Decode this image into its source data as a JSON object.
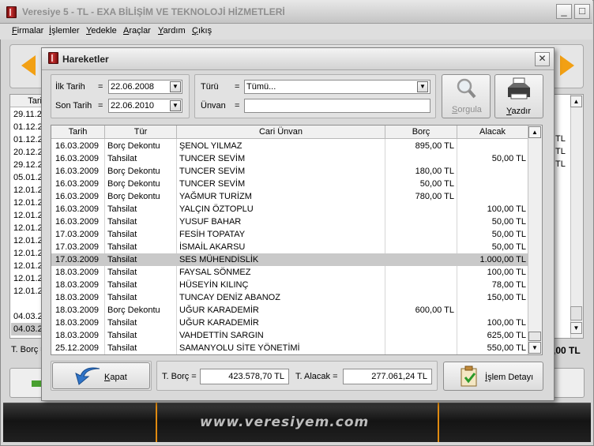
{
  "window": {
    "title": "Veresiye 5 - TL - EXA BİLİŞİM VE TEKNOLOJİ HİZMETLERİ",
    "minimize": "_",
    "restore": "□",
    "close": "✕"
  },
  "menu": [
    "Firmalar",
    "İşlemler",
    "Yedekle",
    "Araçlar",
    "Yardım",
    "Çıkış"
  ],
  "background": {
    "grid_header": "Tari",
    "dates": [
      "29.11.2",
      "01.12.2",
      "01.12.2",
      "20.12.2",
      "29.12.2",
      "05.01.2",
      "12.01.2",
      "12.01.2",
      "12.01.2",
      "12.01.2",
      "12.01.2",
      "12.01.2",
      "12.01.2",
      "12.01.2",
      "12.01.2",
      "04.03.2",
      "04.03.2"
    ],
    "tl_values": [
      "TL",
      "TL",
      "TL",
      "TL"
    ],
    "footer_left": "T. Borç =",
    "footer_right": ",00 TL",
    "banner": "www.veresiyem.com"
  },
  "dialog": {
    "title": "Hareketler",
    "close": "✕",
    "filters": {
      "start_label": "İlk Tarih",
      "start_value": "22.06.2008",
      "end_label": "Son Tarih",
      "end_value": "22.06.2010",
      "type_label": "Türü",
      "type_value": "Tümü...",
      "title_label": "Ünvan",
      "title_value": "",
      "eq": "="
    },
    "query_button": "Sorgula",
    "print_button": "Yazdır",
    "columns": [
      "Tarih",
      "Tür",
      "Cari Ünvan",
      "Borç",
      "Alacak"
    ],
    "rows": [
      {
        "date": "16.03.2009",
        "type": "Borç Dekontu",
        "name": "ŞENOL YILMAZ",
        "debt": "895,00 TL",
        "credit": ""
      },
      {
        "date": "16.03.2009",
        "type": "Tahsilat",
        "name": "TUNCER SEVİM",
        "debt": "",
        "credit": "50,00 TL"
      },
      {
        "date": "16.03.2009",
        "type": "Borç Dekontu",
        "name": "TUNCER SEVİM",
        "debt": "180,00 TL",
        "credit": ""
      },
      {
        "date": "16.03.2009",
        "type": "Borç Dekontu",
        "name": "TUNCER SEVİM",
        "debt": "50,00 TL",
        "credit": ""
      },
      {
        "date": "16.03.2009",
        "type": "Borç Dekontu",
        "name": "YAĞMUR TURİZM",
        "debt": "780,00 TL",
        "credit": ""
      },
      {
        "date": "16.03.2009",
        "type": "Tahsilat",
        "name": "YALÇIN ÖZTOPLU",
        "debt": "",
        "credit": "100,00 TL"
      },
      {
        "date": "16.03.2009",
        "type": "Tahsilat",
        "name": "YUSUF BAHAR",
        "debt": "",
        "credit": "50,00 TL"
      },
      {
        "date": "17.03.2009",
        "type": "Tahsilat",
        "name": "FESİH TOPATAY",
        "debt": "",
        "credit": "50,00 TL"
      },
      {
        "date": "17.03.2009",
        "type": "Tahsilat",
        "name": "İSMAİL AKARSU",
        "debt": "",
        "credit": "50,00 TL"
      },
      {
        "date": "17.03.2009",
        "type": "Tahsilat",
        "name": "SES MÜHENDİSLİK",
        "debt": "",
        "credit": "1.000,00 TL"
      },
      {
        "date": "18.03.2009",
        "type": "Tahsilat",
        "name": "FAYSAL SÖNMEZ",
        "debt": "",
        "credit": "100,00 TL"
      },
      {
        "date": "18.03.2009",
        "type": "Tahsilat",
        "name": "HÜSEYİN KILINÇ",
        "debt": "",
        "credit": "78,00 TL"
      },
      {
        "date": "18.03.2009",
        "type": "Tahsilat",
        "name": "TUNCAY DENİZ ABANOZ",
        "debt": "",
        "credit": "150,00 TL"
      },
      {
        "date": "18.03.2009",
        "type": "Borç Dekontu",
        "name": "UĞUR KARADEMİR",
        "debt": "600,00 TL",
        "credit": ""
      },
      {
        "date": "18.03.2009",
        "type": "Tahsilat",
        "name": "UĞUR KARADEMİR",
        "debt": "",
        "credit": "100,00 TL"
      },
      {
        "date": "18.03.2009",
        "type": "Tahsilat",
        "name": "VAHDETTİN SARGIN",
        "debt": "",
        "credit": "625,00 TL"
      },
      {
        "date": "25.12.2009",
        "type": "Tahsilat",
        "name": "SAMANYOLU SİTE YÖNETİMİ",
        "debt": "",
        "credit": "550,00 TL"
      }
    ],
    "selected_row": 9,
    "close_button": "Kapat",
    "total_debt_label": "T. Borç =",
    "total_debt": "423.578,70 TL",
    "total_credit_label": "T. Alacak =",
    "total_credit": "277.061,24 TL",
    "detail_button": "İşlem Detayı"
  }
}
